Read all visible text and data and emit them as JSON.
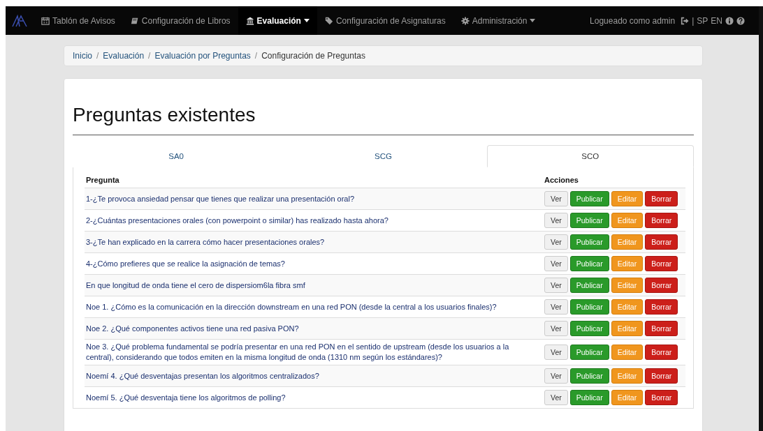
{
  "navbar": {
    "items": [
      {
        "label": "Tablón de Avisos",
        "selected": false,
        "dropdown": false
      },
      {
        "label": "Configuración de Libros",
        "selected": false,
        "dropdown": false
      },
      {
        "label": "Evaluación",
        "selected": true,
        "dropdown": true
      },
      {
        "label": "Configuración de Asignaturas",
        "selected": false,
        "dropdown": false
      },
      {
        "label": "Administración",
        "selected": false,
        "dropdown": true
      }
    ],
    "user_text": "Logueado como admin",
    "separator": "|",
    "languages": [
      "SP",
      "EN"
    ]
  },
  "breadcrumb": [
    {
      "label": "Inicio",
      "kind": "link"
    },
    {
      "label": "/",
      "kind": "separator"
    },
    {
      "label": "Evaluación",
      "kind": "link"
    },
    {
      "label": "/",
      "kind": "separator"
    },
    {
      "label": "Evaluación por Preguntas",
      "kind": "link"
    },
    {
      "label": "/",
      "kind": "separator"
    },
    {
      "label": "Configuración de Preguntas",
      "kind": "current"
    }
  ],
  "title": "Preguntas existentes",
  "tabs": [
    {
      "label": "SA0",
      "selected": false
    },
    {
      "label": "SCG",
      "selected": false
    },
    {
      "label": "SCO",
      "selected": true
    }
  ],
  "table": {
    "columns": [
      "Pregunta",
      "Acciones"
    ],
    "rows": [
      {
        "question": "1-¿Te provoca ansiedad pensar que tienes que realizar una presentación oral?",
        "actions": [
          {
            "label": "Ver",
            "kind": "default"
          },
          {
            "label": "Publicar",
            "kind": "success"
          },
          {
            "label": "Editar",
            "kind": "warning"
          },
          {
            "label": "Borrar",
            "kind": "danger"
          }
        ]
      },
      {
        "question": "2-¿Cuántas presentaciones orales (con powerpoint o similar) has realizado hasta ahora?",
        "actions": [
          {
            "label": "Ver",
            "kind": "default"
          },
          {
            "label": "Publicar",
            "kind": "success"
          },
          {
            "label": "Editar",
            "kind": "warning"
          },
          {
            "label": "Borrar",
            "kind": "danger"
          }
        ]
      },
      {
        "question": "3-¿Te han explicado en la carrera cómo hacer presentaciones orales?",
        "actions": [
          {
            "label": "Ver",
            "kind": "default"
          },
          {
            "label": "Publicar",
            "kind": "success"
          },
          {
            "label": "Editar",
            "kind": "warning"
          },
          {
            "label": "Borrar",
            "kind": "danger"
          }
        ]
      },
      {
        "question": "4-¿Cómo prefieres que se realice la asignación de temas?",
        "actions": [
          {
            "label": "Ver",
            "kind": "default"
          },
          {
            "label": "Publicar",
            "kind": "success"
          },
          {
            "label": "Editar",
            "kind": "warning"
          },
          {
            "label": "Borrar",
            "kind": "danger"
          }
        ]
      },
      {
        "question": "En que longitud de onda tiene el cero de dispersiom6la fibra smf",
        "actions": [
          {
            "label": "Ver",
            "kind": "default"
          },
          {
            "label": "Publicar",
            "kind": "success"
          },
          {
            "label": "Editar",
            "kind": "warning"
          },
          {
            "label": "Borrar",
            "kind": "danger"
          }
        ]
      },
      {
        "question": "Noe 1. ¿Cómo es la comunicación en la dirección downstream en una red PON (desde la central a los usuarios finales)?",
        "actions": [
          {
            "label": "Ver",
            "kind": "default"
          },
          {
            "label": "Publicar",
            "kind": "success"
          },
          {
            "label": "Editar",
            "kind": "warning"
          },
          {
            "label": "Borrar",
            "kind": "danger"
          }
        ]
      },
      {
        "question": "Noe 2. ¿Qué componentes activos tiene una red pasiva PON?",
        "actions": [
          {
            "label": "Ver",
            "kind": "default"
          },
          {
            "label": "Publicar",
            "kind": "success"
          },
          {
            "label": "Editar",
            "kind": "warning"
          },
          {
            "label": "Borrar",
            "kind": "danger"
          }
        ]
      },
      {
        "question": "Noe 3. ¿Qué problema fundamental se podría presentar en una red PON en el sentido de upstream (desde los usuarios a la central), considerando que todos emiten en la misma longitud de onda (1310 nm según los estándares)?",
        "actions": [
          {
            "label": "Ver",
            "kind": "default"
          },
          {
            "label": "Publicar",
            "kind": "success"
          },
          {
            "label": "Editar",
            "kind": "warning"
          },
          {
            "label": "Borrar",
            "kind": "danger"
          }
        ]
      },
      {
        "question": "Noemí 4. ¿Qué desventajas presentan los algoritmos centralizados?",
        "actions": [
          {
            "label": "Ver",
            "kind": "default"
          },
          {
            "label": "Publicar",
            "kind": "success"
          },
          {
            "label": "Editar",
            "kind": "warning"
          },
          {
            "label": "Borrar",
            "kind": "danger"
          }
        ]
      },
      {
        "question": "Noemí 5. ¿Qué desventaja tiene los algoritmos de polling?",
        "actions": [
          {
            "label": "Ver",
            "kind": "default"
          },
          {
            "label": "Publicar",
            "kind": "success"
          },
          {
            "label": "Editar",
            "kind": "warning"
          },
          {
            "label": "Borrar",
            "kind": "danger"
          }
        ]
      }
    ]
  }
}
